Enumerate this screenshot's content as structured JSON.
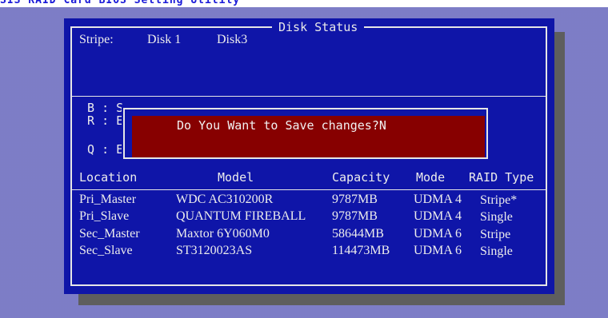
{
  "app_title": "SIS RAID Card BIOS Setting Utility",
  "window": {
    "title": "Disk Status"
  },
  "stripe": {
    "label": "Stripe:",
    "disks": [
      "Disk 1",
      "Disk3"
    ]
  },
  "legend": [
    {
      "key": "B",
      "sep": ":",
      "text": "S"
    },
    {
      "key": "R",
      "sep": ":",
      "text": "E"
    },
    {
      "key": "Q",
      "sep": ":",
      "text": "E"
    }
  ],
  "dialog": {
    "message": "Do You Want to Save changes?N"
  },
  "table": {
    "headers": [
      "Location",
      "Model",
      "Capacity",
      "Mode",
      "RAID Type"
    ],
    "rows": [
      [
        "Pri_Master",
        "WDC AC310200R",
        "9787MB",
        "UDMA 4",
        "Stripe*"
      ],
      [
        "Pri_Slave",
        "QUANTUM FIREBALL",
        "9787MB",
        "UDMA 4",
        "Single"
      ],
      [
        "Sec_Master",
        "Maxtor 6Y060M0",
        "58644MB",
        "UDMA 6",
        "Stripe"
      ],
      [
        "Sec_Slave",
        "ST3120023AS",
        "114473MB",
        "UDMA 6",
        "Single"
      ]
    ]
  },
  "colors": {
    "background": "#10108f",
    "panel": "#0f15a8",
    "dialog": "#870000",
    "text": "#ececec",
    "title_bar": "#ffffff"
  }
}
